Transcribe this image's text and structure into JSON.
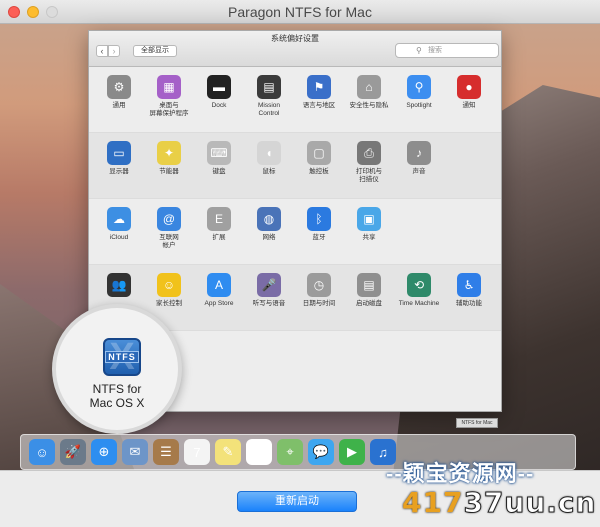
{
  "app": {
    "title": "Paragon NTFS for Mac"
  },
  "prefs": {
    "title": "系统偏好设置",
    "show_all": "全部显示",
    "search_placeholder": "搜索",
    "rows": [
      {
        "items": [
          {
            "name": "general-icon",
            "label": "通用",
            "color": "#8a8a8a",
            "glyph": "⚙"
          },
          {
            "name": "desktop-icon",
            "label": "桌面与\n屏幕保护程序",
            "color": "#a560c8",
            "glyph": "▦"
          },
          {
            "name": "dock-icon",
            "label": "Dock",
            "color": "#222222",
            "glyph": "▬"
          },
          {
            "name": "mission-control-icon",
            "label": "Mission\nControl",
            "color": "#3b3b3b",
            "glyph": "▤"
          },
          {
            "name": "language-icon",
            "label": "语言与地区",
            "color": "#3a6fc9",
            "glyph": "⚑"
          },
          {
            "name": "security-icon",
            "label": "安全性与隐私",
            "color": "#9a9a9a",
            "glyph": "⌂"
          },
          {
            "name": "spotlight-icon",
            "label": "Spotlight",
            "color": "#3c8ef0",
            "glyph": "⚲"
          },
          {
            "name": "notifications-icon",
            "label": "通知",
            "color": "#d62d2d",
            "glyph": "●"
          }
        ]
      },
      {
        "items": [
          {
            "name": "displays-icon",
            "label": "显示器",
            "color": "#2f6fc4",
            "glyph": "▭"
          },
          {
            "name": "energy-saver-icon",
            "label": "节能器",
            "color": "#e9cf47",
            "glyph": "✦"
          },
          {
            "name": "keyboard-icon",
            "label": "键盘",
            "color": "#b9b9b9",
            "glyph": "⌨"
          },
          {
            "name": "mouse-icon",
            "label": "鼠标",
            "color": "#d5d5d5",
            "glyph": "◖"
          },
          {
            "name": "trackpad-icon",
            "label": "触控板",
            "color": "#a9a9a9",
            "glyph": "▢"
          },
          {
            "name": "printers-icon",
            "label": "打印机与\n扫描仪",
            "color": "#777777",
            "glyph": "⎙"
          },
          {
            "name": "sound-icon",
            "label": "声音",
            "color": "#8d8d8d",
            "glyph": "♪"
          }
        ]
      },
      {
        "items": [
          {
            "name": "icloud-icon",
            "label": "iCloud",
            "color": "#3d8fe3",
            "glyph": "☁"
          },
          {
            "name": "internet-accounts-icon",
            "label": "互联网\n帐户",
            "color": "#3a86e0",
            "glyph": "@"
          },
          {
            "name": "extensions-icon",
            "label": "扩展",
            "color": "#a0a0a0",
            "glyph": "E"
          },
          {
            "name": "network-icon",
            "label": "网络",
            "color": "#4a73b8",
            "glyph": "◍"
          },
          {
            "name": "bluetooth-icon",
            "label": "蓝牙",
            "color": "#2b7ae0",
            "glyph": "ᛒ"
          },
          {
            "name": "sharing-icon",
            "label": "共享",
            "color": "#4aa7e8",
            "glyph": "▣"
          }
        ]
      },
      {
        "items": [
          {
            "name": "users-icon",
            "label": "",
            "color": "#333333",
            "glyph": "👥"
          },
          {
            "name": "parental-controls-icon",
            "label": "家长控制",
            "color": "#f1c21b",
            "glyph": "☺"
          },
          {
            "name": "app-store-icon",
            "label": "App Store",
            "color": "#2f8cf0",
            "glyph": "A"
          },
          {
            "name": "dictation-icon",
            "label": "听写与语音",
            "color": "#7a6ca6",
            "glyph": "🎤"
          },
          {
            "name": "date-time-icon",
            "label": "日期与时间",
            "color": "#9b9b9b",
            "glyph": "◷"
          },
          {
            "name": "startup-disk-icon",
            "label": "启动磁盘",
            "color": "#8f8f8f",
            "glyph": "▤"
          },
          {
            "name": "time-machine-icon",
            "label": "Time Machine",
            "color": "#2f8a6a",
            "glyph": "⟲"
          },
          {
            "name": "accessibility-icon",
            "label": "辅助功能",
            "color": "#2f7ee8",
            "glyph": "♿"
          }
        ]
      }
    ]
  },
  "magnifier": {
    "label": "NTFS for\nMac OS X",
    "icon_text": "NTFS"
  },
  "corner_badge": "NTFS for Mac",
  "dock": {
    "items": [
      {
        "name": "finder-icon",
        "color": "#3b8fe6",
        "glyph": "☺"
      },
      {
        "name": "launchpad-icon",
        "color": "#6b7a8a",
        "glyph": "🚀"
      },
      {
        "name": "safari-icon",
        "color": "#2d8ef0",
        "glyph": "⊕"
      },
      {
        "name": "mail-icon",
        "color": "#6d95c8",
        "glyph": "✉"
      },
      {
        "name": "contacts-icon",
        "color": "#a67a4a",
        "glyph": "☰"
      },
      {
        "name": "calendar-icon",
        "color": "#f4f4f4",
        "glyph": "7"
      },
      {
        "name": "notes-icon",
        "color": "#f3e27a",
        "glyph": "✎"
      },
      {
        "name": "reminders-icon",
        "color": "#ffffff",
        "glyph": "☑"
      },
      {
        "name": "maps-icon",
        "color": "#7fbf6a",
        "glyph": "⌖"
      },
      {
        "name": "messages-icon",
        "color": "#3da6f0",
        "glyph": "💬"
      },
      {
        "name": "facetime-icon",
        "color": "#3fb24a",
        "glyph": "▶"
      },
      {
        "name": "itunes-icon",
        "color": "#2a72d0",
        "glyph": "♫"
      }
    ]
  },
  "watermark": {
    "top": "--颖宝资源网--",
    "nums": "417",
    "dom": "37uu.cn"
  },
  "bottom": {
    "restart_label": "重新启动"
  }
}
